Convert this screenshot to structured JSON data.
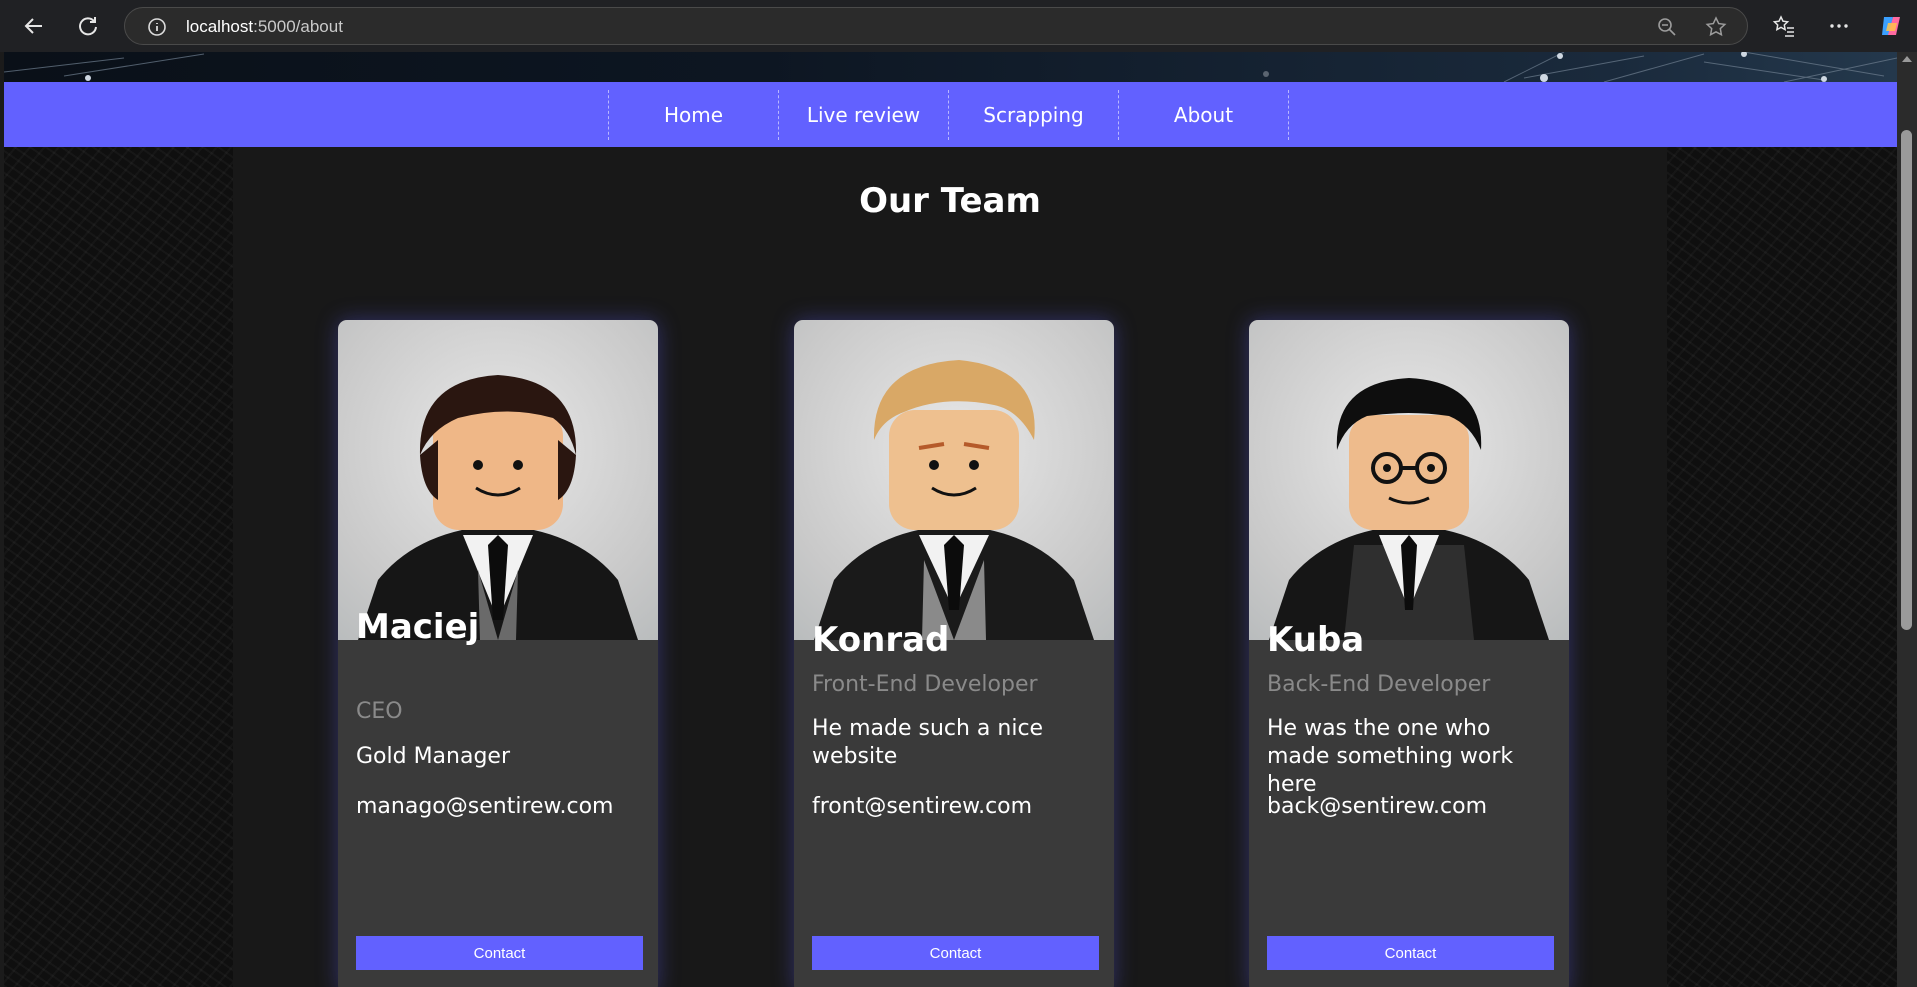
{
  "browser": {
    "url_host": "localhost",
    "url_path": ":5000/about"
  },
  "nav": {
    "items": [
      {
        "label": "Home"
      },
      {
        "label": "Live review"
      },
      {
        "label": "Scrapping"
      },
      {
        "label": "About"
      }
    ]
  },
  "page": {
    "title": "Our Team"
  },
  "team": [
    {
      "name": "Maciej",
      "role": "CEO",
      "description": "Gold Manager",
      "email": "manago@sentirew.com",
      "button": "Contact",
      "hair": "#2a1610",
      "photo_bg": "#cfcfcf"
    },
    {
      "name": "Konrad",
      "role": "Front-End Developer",
      "description": "He made such a nice website",
      "email": "front@sentirew.com",
      "button": "Contact",
      "hair": "#d9a866",
      "photo_bg": "#c4c7c6"
    },
    {
      "name": "Kuba",
      "role": "Back-End Developer",
      "description": "He was the one who made something work here",
      "email": "back@sentirew.com",
      "button": "Contact",
      "hair": "#0e0e0e",
      "photo_bg": "#c9c9c9"
    }
  ],
  "colors": {
    "accent": "#6261ff",
    "card_bg": "#3a3a3a",
    "content_bg": "#181818",
    "role_text": "#8a8a8a"
  }
}
